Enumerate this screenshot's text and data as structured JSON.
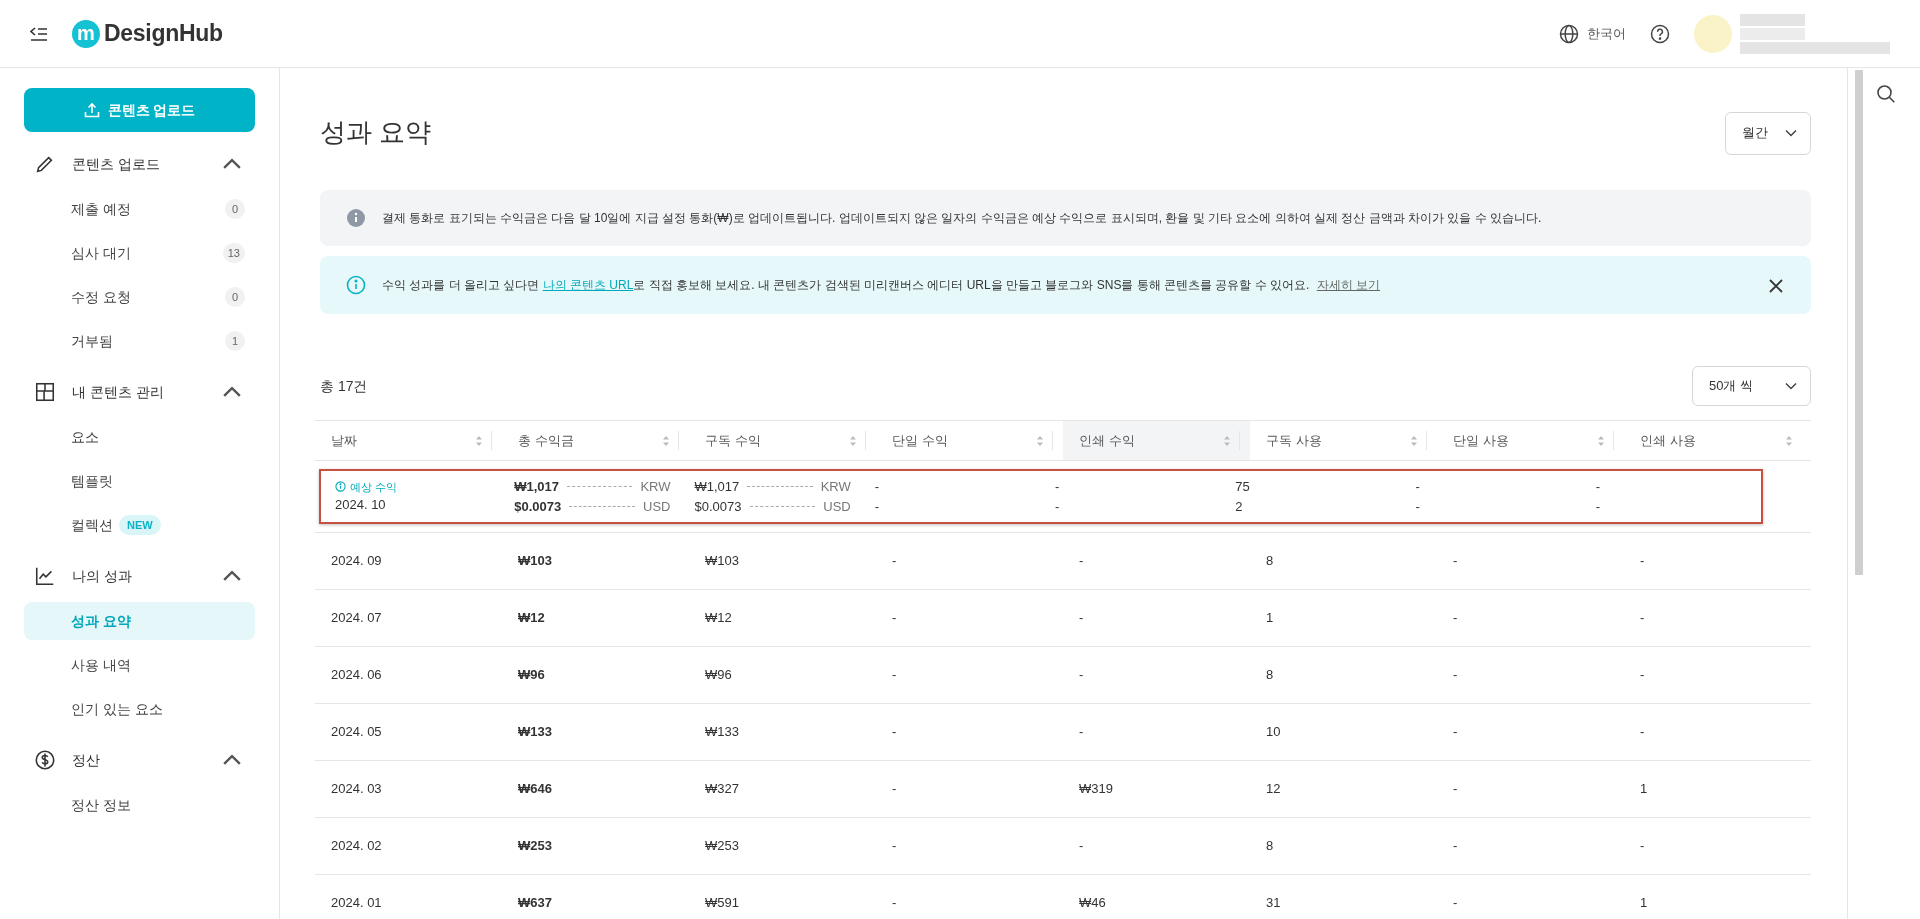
{
  "header": {
    "logo_mark": "m",
    "logo_text": "DesignHub",
    "language": "한국어"
  },
  "sidebar": {
    "upload_button": "콘텐츠 업로드",
    "sections": [
      {
        "kind": "upload",
        "label": "콘텐츠 업로드",
        "expanded": true,
        "items": [
          {
            "label": "제출 예정",
            "count": "0",
            "selected": false
          },
          {
            "label": "심사 대기",
            "count": "13",
            "selected": false
          },
          {
            "label": "수정 요청",
            "count": "0",
            "selected": false
          },
          {
            "label": "거부됨",
            "count": "1",
            "selected": false
          }
        ]
      },
      {
        "kind": "contents",
        "label": "내 콘텐츠 관리",
        "expanded": true,
        "items": [
          {
            "label": "요소",
            "selected": false
          },
          {
            "label": "템플릿",
            "selected": false
          },
          {
            "label": "컬렉션",
            "badge": "NEW",
            "selected": false
          }
        ]
      },
      {
        "kind": "performance",
        "label": "나의 성과",
        "expanded": true,
        "items": [
          {
            "label": "성과 요약",
            "selected": true
          },
          {
            "label": "사용 내역",
            "selected": false
          },
          {
            "label": "인기 있는 요소",
            "selected": false
          }
        ]
      },
      {
        "kind": "settlement",
        "label": "정산",
        "expanded": true,
        "items": [
          {
            "label": "정산 정보",
            "selected": false
          }
        ]
      }
    ]
  },
  "page": {
    "title": "성과 요약",
    "period_select": "월간",
    "notices": [
      {
        "kind": "neutral",
        "text": "결제 통화로 표기되는 수익금은 다음 달 10일에 지급 설정 통화(₩)로 업데이트됩니다. 업데이트되지 않은 일자의 수익금은 예상 수익으로 표시되며, 환율 및 기타 요소에 의하여 실제 정산 금액과 차이가 있을 수 있습니다."
      },
      {
        "kind": "info",
        "text_before": "수익 성과를 더 올리고 싶다면 ",
        "link": "나의 콘텐츠 URL",
        "text_after": "로 직접 홍보해 보세요. 내 콘텐츠가 검색된 미리캔버스 에디터 URL을 만들고 블로그와 SNS를 통해 콘텐츠를 공유할 수 있어요.",
        "more_link": "자세히 보기",
        "dismissible": true
      }
    ]
  },
  "table": {
    "total": "총 17건",
    "page_size": "50개 씩",
    "columns": [
      {
        "label": "날짜",
        "highlighted": false
      },
      {
        "label": "총 수익금",
        "highlighted": false
      },
      {
        "label": "구독 수익",
        "highlighted": false
      },
      {
        "label": "단일 수익",
        "highlighted": false
      },
      {
        "label": "인쇄 수익",
        "highlighted": true
      },
      {
        "label": "구독 사용",
        "highlighted": false
      },
      {
        "label": "단일 사용",
        "highlighted": false
      },
      {
        "label": "인쇄 사용",
        "highlighted": false
      }
    ],
    "estimate_row": {
      "flagged": true,
      "label": "예상 수익",
      "date": "2024. 10",
      "total": [
        {
          "amount": "₩1,017",
          "currency": "KRW"
        },
        {
          "amount": "$0.0073",
          "currency": "USD"
        }
      ],
      "subscription": [
        {
          "amount": "₩1,017",
          "currency": "KRW"
        },
        {
          "amount": "$0.0073",
          "currency": "USD"
        }
      ],
      "other": [
        [
          "-",
          "-"
        ],
        [
          "-",
          "-"
        ],
        [
          "75",
          "2"
        ],
        [
          "-",
          "-"
        ],
        [
          "-",
          "-"
        ]
      ]
    },
    "rows": [
      [
        "2024. 09",
        "₩103",
        "₩103",
        "-",
        "-",
        "8",
        "-",
        "-"
      ],
      [
        "2024. 07",
        "₩12",
        "₩12",
        "-",
        "-",
        "1",
        "-",
        "-"
      ],
      [
        "2024. 06",
        "₩96",
        "₩96",
        "-",
        "-",
        "8",
        "-",
        "-"
      ],
      [
        "2024. 05",
        "₩133",
        "₩133",
        "-",
        "-",
        "10",
        "-",
        "-"
      ],
      [
        "2024. 03",
        "₩646",
        "₩327",
        "-",
        "₩319",
        "12",
        "-",
        "1"
      ],
      [
        "2024. 02",
        "₩253",
        "₩253",
        "-",
        "-",
        "8",
        "-",
        "-"
      ],
      [
        "2024. 01",
        "₩637",
        "₩591",
        "-",
        "₩46",
        "31",
        "-",
        "1"
      ]
    ]
  }
}
